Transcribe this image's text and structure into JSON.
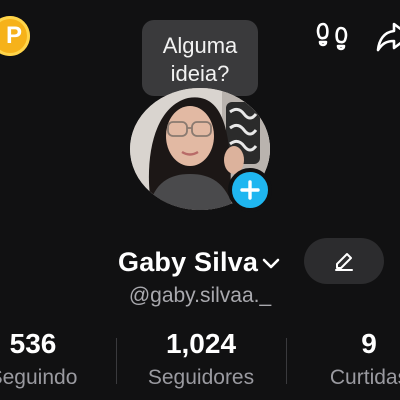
{
  "header": {
    "coin_symbol": "P",
    "coin_color": "#f6b21a",
    "icons": [
      "footprints-icon",
      "share-icon"
    ]
  },
  "note_bubble": {
    "line1": "Alguma",
    "line2": "ideia?"
  },
  "profile": {
    "display_name": "Gaby Silva",
    "username": "@gaby.silvaa._",
    "accent_color": "#1fb6f0"
  },
  "stats": {
    "following_value": "536",
    "following_label": "Seguindo",
    "followers_value": "1,024",
    "followers_label": "Seguidores",
    "likes_value": "9",
    "likes_label": "Curtidas"
  }
}
